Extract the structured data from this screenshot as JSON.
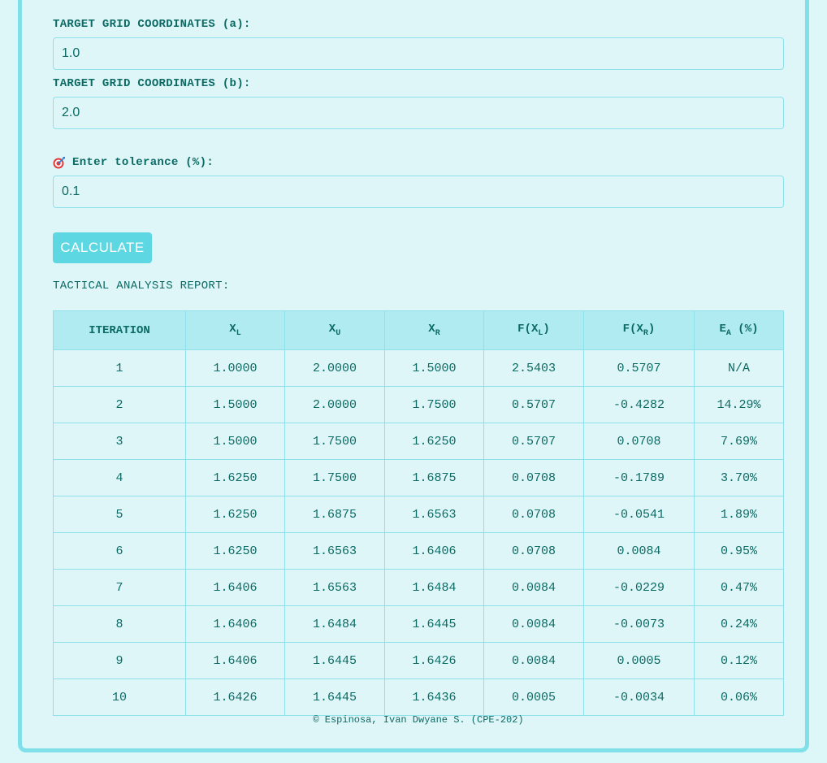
{
  "inputs": {
    "a_label": "TARGET GRID COORDINATES (a):",
    "a_value": "1.0",
    "b_label": "TARGET GRID COORDINATES (b):",
    "b_value": "2.0",
    "tolerance_label": "Enter tolerance (%):",
    "tolerance_value": "0.1"
  },
  "button": {
    "label": "CALCULATE"
  },
  "report": {
    "title": "TACTICAL ANALYSIS REPORT:",
    "headers": {
      "iteration": "ITERATION",
      "xl": {
        "main": "X",
        "sub": "L"
      },
      "xu": {
        "main": "X",
        "sub": "U"
      },
      "xr": {
        "main": "X",
        "sub": "R"
      },
      "fxl": {
        "pre": "F(X",
        "sub": "L",
        "post": ")"
      },
      "fxr": {
        "pre": "F(X",
        "sub": "R",
        "post": ")"
      },
      "ea": {
        "main": "E",
        "sub": "A",
        "post": " (%)"
      }
    },
    "rows": [
      [
        "1",
        "1.0000",
        "2.0000",
        "1.5000",
        "2.5403",
        "0.5707",
        "N/A"
      ],
      [
        "2",
        "1.5000",
        "2.0000",
        "1.7500",
        "0.5707",
        "-0.4282",
        "14.29%"
      ],
      [
        "3",
        "1.5000",
        "1.7500",
        "1.6250",
        "0.5707",
        "0.0708",
        "7.69%"
      ],
      [
        "4",
        "1.6250",
        "1.7500",
        "1.6875",
        "0.0708",
        "-0.1789",
        "3.70%"
      ],
      [
        "5",
        "1.6250",
        "1.6875",
        "1.6563",
        "0.0708",
        "-0.0541",
        "1.89%"
      ],
      [
        "6",
        "1.6250",
        "1.6563",
        "1.6406",
        "0.0708",
        "0.0084",
        "0.95%"
      ],
      [
        "7",
        "1.6406",
        "1.6563",
        "1.6484",
        "0.0084",
        "-0.0229",
        "0.47%"
      ],
      [
        "8",
        "1.6406",
        "1.6484",
        "1.6445",
        "0.0084",
        "-0.0073",
        "0.24%"
      ],
      [
        "9",
        "1.6406",
        "1.6445",
        "1.6426",
        "0.0084",
        "0.0005",
        "0.12%"
      ],
      [
        "10",
        "1.6426",
        "1.6445",
        "1.6436",
        "0.0005",
        "-0.0034",
        "0.06%"
      ]
    ]
  },
  "footer": {
    "text": "© Espinosa, Ivan Dwyane S. (CPE-202)"
  },
  "colors": {
    "background": "#def6f7",
    "accent": "#5dd7e2",
    "border": "#8fe0ea",
    "text": "#0c6a64",
    "header_bg": "#b0ebf1"
  },
  "icons": {
    "tolerance": "target-icon"
  }
}
